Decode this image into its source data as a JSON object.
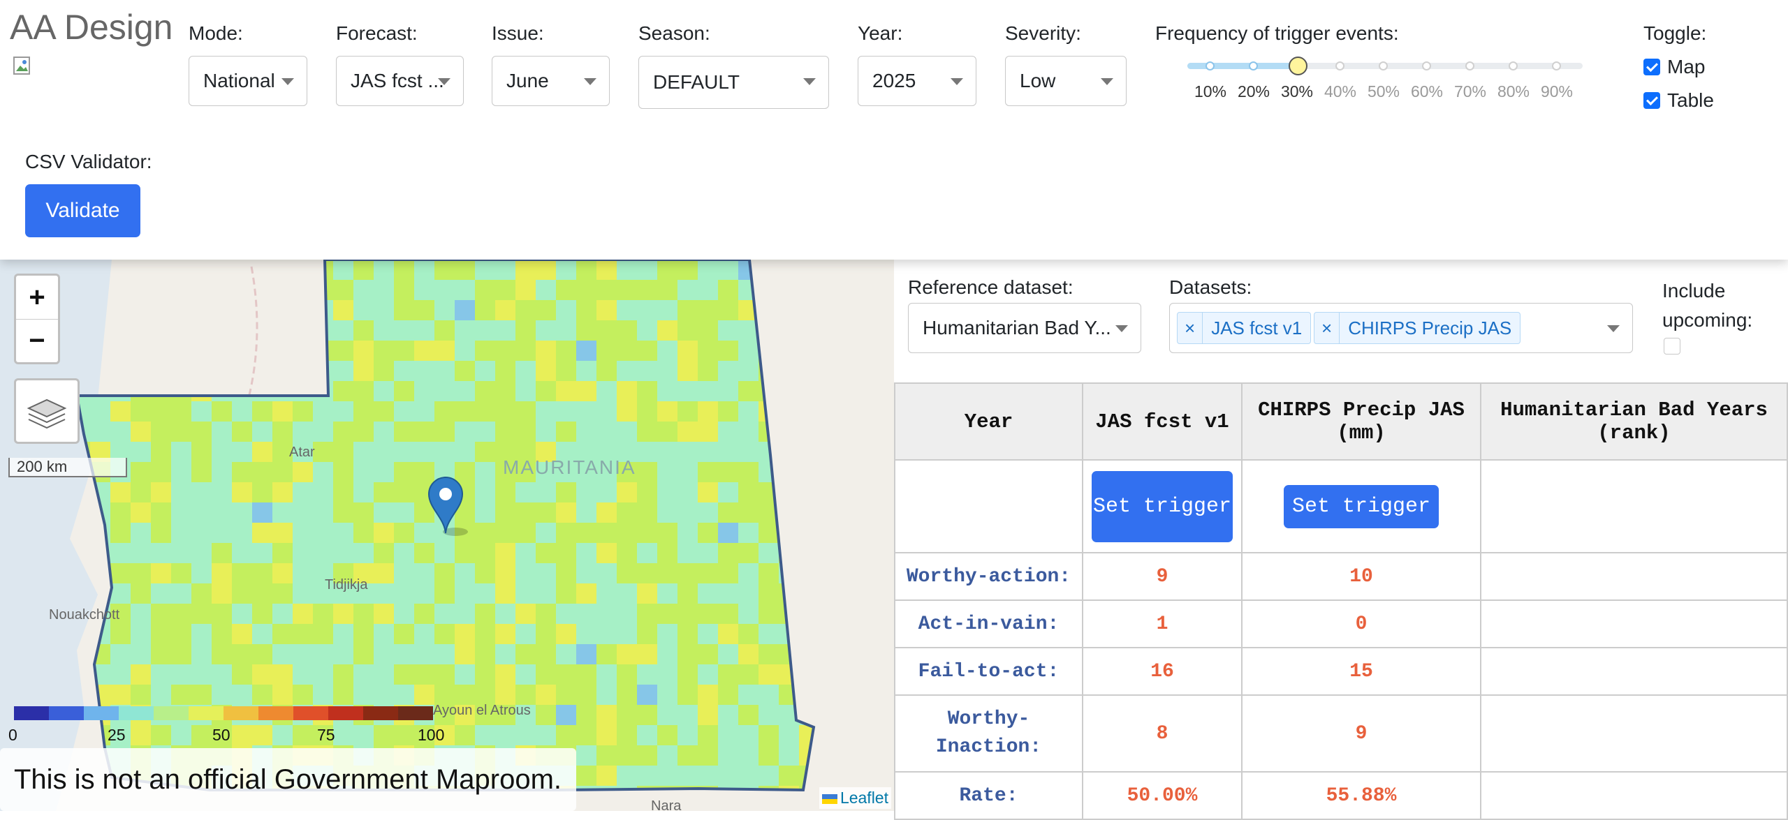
{
  "header": {
    "title": "AA Design"
  },
  "controls": {
    "mode": {
      "label": "Mode:",
      "value": "National"
    },
    "forecast": {
      "label": "Forecast:",
      "value": "JAS fcst ..."
    },
    "issue": {
      "label": "Issue:",
      "value": "June"
    },
    "season": {
      "label": "Season:",
      "value": "DEFAULT"
    },
    "year": {
      "label": "Year:",
      "value": "2025"
    },
    "severity": {
      "label": "Severity:",
      "value": "Low"
    },
    "frequency": {
      "label": "Frequency of trigger events:",
      "marks": [
        "10%",
        "20%",
        "30%",
        "40%",
        "50%",
        "60%",
        "70%",
        "80%",
        "90%"
      ],
      "selected": "30%"
    },
    "toggle": {
      "label": "Toggle:",
      "map": "Map",
      "table": "Table"
    },
    "csv": {
      "label": "CSV Validator:",
      "button": "Validate"
    }
  },
  "map": {
    "zoom_in": "+",
    "zoom_out": "−",
    "scale": "200 km",
    "legend_ticks": [
      "0",
      "25",
      "50",
      "75",
      "100"
    ],
    "legend_colors": [
      "#2b2fa8",
      "#3a5fd9",
      "#6fb4ec",
      "#8fe6d4",
      "#b8ef8a",
      "#e5f05a",
      "#f0c040",
      "#ee8a30",
      "#e0502a",
      "#c0301e",
      "#8a2a14",
      "#6b2a1a"
    ],
    "cell_colors": [
      "#a6f0c6",
      "#c4ef5e",
      "#e8ef58",
      "#86c6e8"
    ],
    "disclaimer": "This is not an official Government Maproom.",
    "attribution": "Leaflet",
    "place_labels": [
      "MAURITANIA",
      "Nouakchott",
      "Tidjikja",
      "Atar",
      "Ayoun el Atrous",
      "Nara"
    ]
  },
  "panel": {
    "reference": {
      "label": "Reference dataset:",
      "value": "Humanitarian Bad Y..."
    },
    "datasets": {
      "label": "Datasets:",
      "tags": [
        "JAS fcst v1",
        "CHIRPS Precip JAS"
      ]
    },
    "include_upcoming": "Include upcoming:",
    "table": {
      "headers": [
        "Year",
        "JAS fcst v1",
        "CHIRPS Precip JAS (mm)",
        "Humanitarian Bad Years (rank)"
      ],
      "set_trigger": "Set trigger",
      "rows": [
        {
          "label": "Worthy-action:",
          "v1": "9",
          "v2": "10"
        },
        {
          "label": "Act-in-vain:",
          "v1": "1",
          "v2": "0"
        },
        {
          "label": "Fail-to-act:",
          "v1": "16",
          "v2": "15"
        },
        {
          "label": "Worthy-Inaction:",
          "v1": "8",
          "v2": "9"
        },
        {
          "label": "Rate:",
          "v1": "50.00%",
          "v2": "55.88%"
        }
      ]
    }
  }
}
